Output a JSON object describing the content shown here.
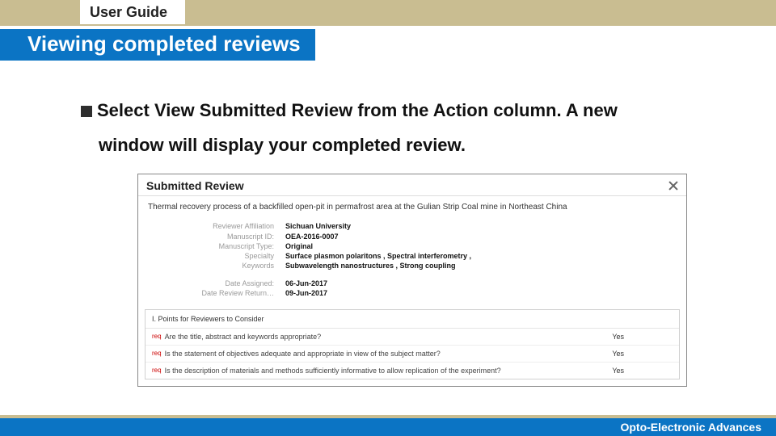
{
  "top": {
    "title": "User Guide"
  },
  "heading": "Viewing completed reviews",
  "instruction": {
    "pre": "Select ",
    "link": "View Submitted Review",
    "post": " from the Action column. A new",
    "line2": "window will display your completed review."
  },
  "modal": {
    "title": "Submitted Review",
    "paper_title": "Thermal recovery process of a backfilled open-pit in permafrost area at the Gulian Strip Coal mine in Northeast China",
    "meta": [
      {
        "label": "Reviewer Affiliation",
        "value": "Sichuan University"
      },
      {
        "label": "Manuscript ID:",
        "value": "OEA-2016-0007"
      },
      {
        "label": "Manuscript Type:",
        "value": "Original"
      },
      {
        "label": "Specialty",
        "value": "Surface plasmon polaritons , Spectral interferometry ,"
      },
      {
        "label": "Keywords",
        "value": "Subwavelength nanostructures , Strong coupling"
      }
    ],
    "meta2": [
      {
        "label": "Date Assigned:",
        "value": "06-Jun-2017"
      },
      {
        "label": "Date Review Return…",
        "value": "09-Jun-2017"
      }
    ],
    "questions": {
      "header": "I. Points for Reviewers to Consider",
      "items": [
        {
          "q": "Are the title, abstract and keywords appropriate?",
          "a": "Yes"
        },
        {
          "q": "Is the statement of objectives adequate and appropriate in view of the subject matter?",
          "a": "Yes"
        },
        {
          "q": "Is the description of materials and methods sufficiently informative to allow replication of the experiment?",
          "a": "Yes"
        }
      ]
    }
  },
  "footer": {
    "brand": "Opto-Electronic Advances"
  }
}
